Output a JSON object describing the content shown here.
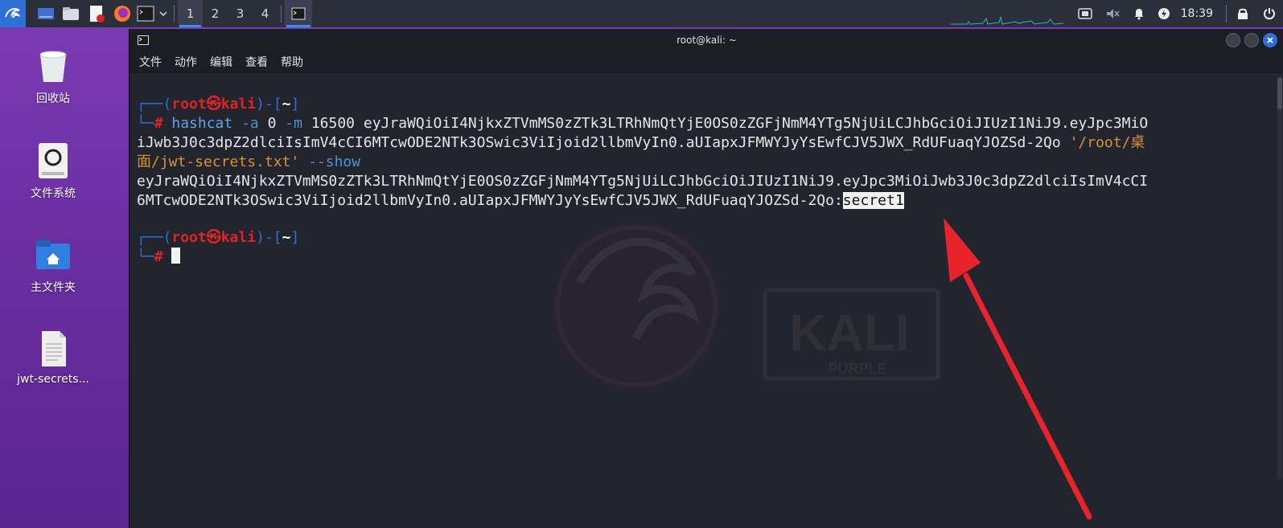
{
  "taskbar": {
    "workspaces": [
      "1",
      "2",
      "3",
      "4"
    ],
    "active_workspace": "1",
    "clock": "18:39"
  },
  "desktop": {
    "icons": [
      {
        "label": "回收站",
        "icon": "trash-icon"
      },
      {
        "label": "文件系统",
        "icon": "drive-icon"
      },
      {
        "label": "主文件夹",
        "icon": "home-folder-icon"
      },
      {
        "label": "jwt-secrets...",
        "icon": "text-file-icon"
      }
    ]
  },
  "window": {
    "title": "root@kali: ~",
    "menu": [
      "文件",
      "动作",
      "编辑",
      "查看",
      "帮助"
    ]
  },
  "terminal": {
    "prompt": {
      "open": "┌──(",
      "user": "root",
      "at": "㉿",
      "host": "kali",
      "mid": ")-[",
      "dir": "~",
      "close": "]",
      "hash_prefix": "└─",
      "hash": "#"
    },
    "command": {
      "program": "hashcat",
      "flag_a": "-a",
      "mode_a": "0",
      "flag_m": "-m",
      "mode_m": "16500",
      "token_line1": "eyJraWQiOiI4NjkxZTVmMS0zZTk3LTRhNmQtYjE0OS0zZGFjNmM4YTg5NjUiLCJhbGciOiJIUzI1NiJ9.eyJpc3MiO",
      "token_line2": "iJwb3J0c3dpZ2dlciIsImV4cCI6MTcwODE2NTk3OSwic3ViIjoid2llbmVyIn0.aUIapxJFMWYJyYsEwfCJV5JWX_RdUFuaqYJOZSd-2Qo",
      "path_a": "'/root/桌",
      "path_b": "面/jwt-secrets.txt'",
      "flag_show": "--show"
    },
    "output": {
      "line1": "eyJraWQiOiI4NjkxZTVmMS0zZTk3LTRhNmQtYjE0OS0zZGFjNmM4YTg5NjUiLCJhbGciOiJIUzI1NiJ9.eyJpc3MiOiJwb3J0c3dpZ2dlciIsImV4cCI",
      "line2": "6MTcwODE2NTk3OSwic3ViIjoid2llbmVyIn0.aUIapxJFMWYJyYsEwfCJV5JWX_RdUFuaqYJOZSd-2Qo:",
      "secret": "secret1"
    }
  },
  "colors": {
    "annotation_arrow": "#e8232b",
    "prompt_red": "#e02424",
    "prompt_blue": "#2f6fd8",
    "string_orange": "#d8932f"
  }
}
